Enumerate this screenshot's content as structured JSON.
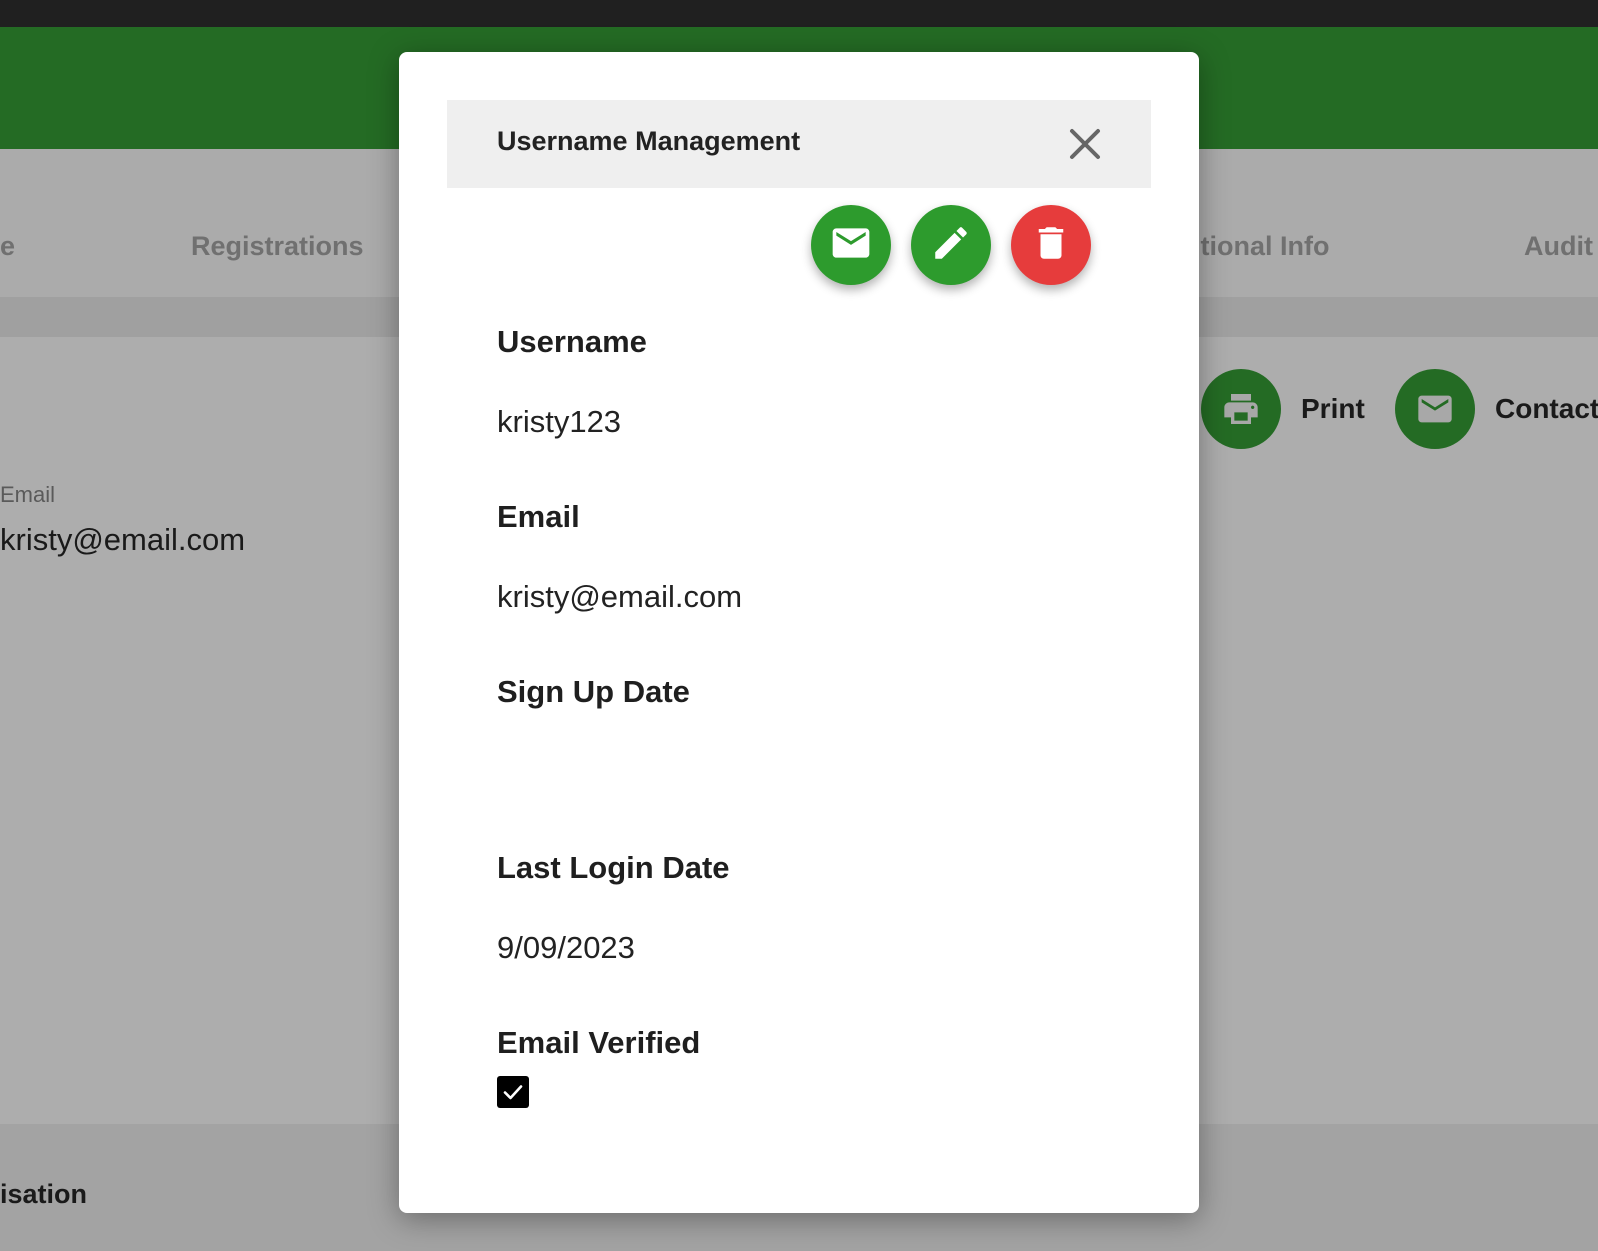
{
  "background": {
    "tabs": [
      "e",
      "Registrations",
      "itional Info",
      "Audit"
    ],
    "email_label": "Email",
    "email_value": "kristy@email.com",
    "actions": {
      "print_label": "Print",
      "contact_label": "Contact"
    },
    "bottom_label": "isation"
  },
  "modal": {
    "title": "Username Management",
    "fields": {
      "username_label": "Username",
      "username_value": "kristy123",
      "email_label": "Email",
      "email_value": "kristy@email.com",
      "signup_label": "Sign Up Date",
      "signup_value": "",
      "last_login_label": "Last Login Date",
      "last_login_value": "9/09/2023",
      "email_verified_label": "Email Verified",
      "email_verified": true
    },
    "buttons": {
      "email_icon": "mail-icon",
      "edit_icon": "pencil-icon",
      "delete_icon": "trash-icon",
      "close_icon": "close-icon"
    }
  },
  "colors": {
    "brand_green": "#246b24",
    "fab_green": "#2d9b2d",
    "danger_red": "#e63c3c"
  }
}
